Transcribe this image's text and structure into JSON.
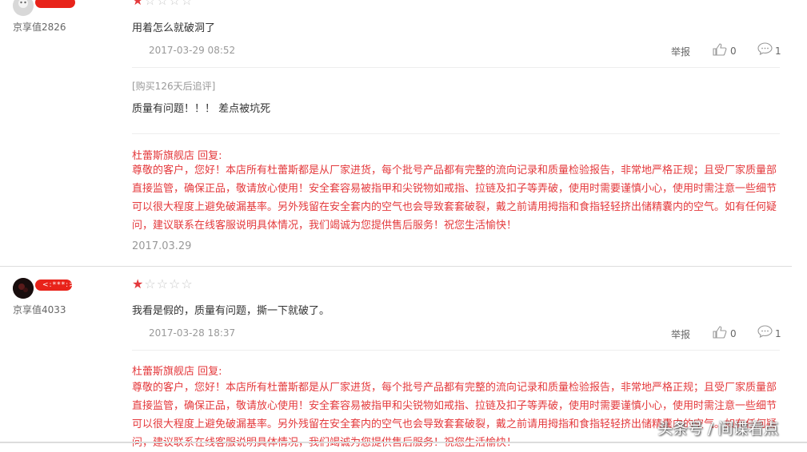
{
  "reviews": [
    {
      "nickname": "",
      "level": "京享值2826",
      "rating": 1,
      "max_rating": 5,
      "content": "用着怎么就破洞了",
      "date": "2017-03-29 08:52",
      "report_label": "举报",
      "like_count": "0",
      "comment_count": "1",
      "append": {
        "label": "[购买126天后追评]",
        "content": "质量有问题！！！ 差点被坑死"
      },
      "reply": {
        "title": "杜蕾斯旗舰店 回复:",
        "text": "尊敬的客户，您好！本店所有杜蕾斯都是从厂家进货，每个批号产品都有完整的流向记录和质量检验报告，非常地严格正规；且受厂家质量部直接监管，确保正品，敬请放心使用！安全套容易被指甲和尖锐物如戒指、拉链及扣子等弄破，使用时需要谨慎小心，使用时需注意一些细节可以很大程度上避免破漏基率。另外残留在安全套内的空气也会导致套套破裂，戴之前请用拇指和食指轻轻挤出储精囊内的空气。如有任何疑问，建议联系在线客服说明具体情况，我们竭诚为您提供售后服务！祝您生活愉快！",
        "date": "2017.03.29"
      }
    },
    {
      "nickname": "<:***:>",
      "level": "京享值4033",
      "rating": 1,
      "max_rating": 5,
      "content": "我看是假的，质量有问题，撕一下就破了。",
      "date": "2017-03-28 18:37",
      "report_label": "举报",
      "like_count": "0",
      "comment_count": "1",
      "reply": {
        "title": "杜蕾斯旗舰店 回复:",
        "text": "尊敬的客户，您好！本店所有杜蕾斯都是从厂家进货，每个批号产品都有完整的流向记录和质量检验报告，非常地严格正规；且受厂家质量部直接监管，确保正品，敬请放心使用！安全套容易被指甲和尖锐物如戒指、拉链及扣子等弄破，使用时需要谨慎小心，使用时需注意一些细节可以很大程度上避免破漏基率。另外残留在安全套内的空气也会导致套套破裂，戴之前请用拇指和食指轻轻挤出储精囊内的空气。如有任何疑问，建议联系在线客服说明具体情况，我们竭诚为您提供售后服务！祝您生活愉快！"
      }
    }
  ],
  "watermark": "头条号 / 间谍看点",
  "colors": {
    "accent": "#e4393c",
    "redaction": "#e8231a",
    "muted": "#999999"
  },
  "icons": {
    "like": "thumbs-up-icon",
    "comment": "comment-bubble-icon",
    "star_filled": "star-filled-icon",
    "star_empty": "star-empty-icon"
  }
}
